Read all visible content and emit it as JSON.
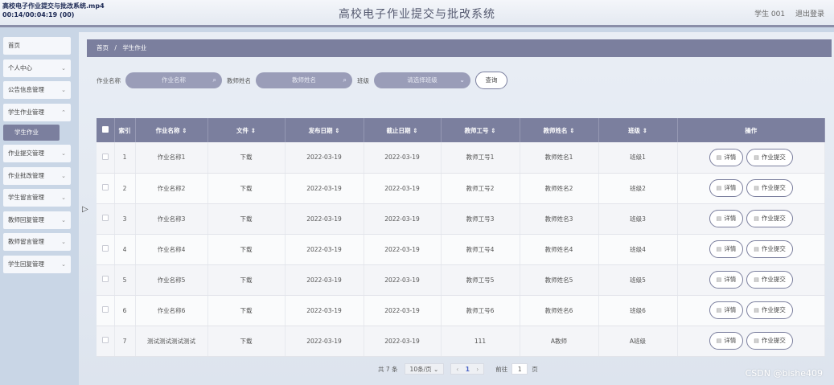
{
  "overlay": {
    "line1": "高校电子作业提交与批改系统.mp4",
    "line2": "00:14/00:04:19 (00)"
  },
  "header": {
    "title": "高校电子作业提交与批改系统",
    "user": "学生 001",
    "logout": "退出登录"
  },
  "sidebar": {
    "items": [
      {
        "label": "首页",
        "chev": ""
      },
      {
        "label": "个人中心",
        "chev": "⌄"
      },
      {
        "label": "公告信息管理",
        "chev": "⌄"
      },
      {
        "label": "学生作业管理",
        "chev": "⌃"
      }
    ],
    "active_sub": "学生作业",
    "items2": [
      {
        "label": "作业提交管理",
        "chev": "⌄"
      },
      {
        "label": "作业批改管理",
        "chev": "⌄"
      },
      {
        "label": "学生留言管理",
        "chev": "⌄"
      },
      {
        "label": "教师回复管理",
        "chev": "⌄"
      },
      {
        "label": "教师留言管理",
        "chev": "⌄"
      },
      {
        "label": "学生回复管理",
        "chev": "⌄"
      }
    ]
  },
  "breadcrumb": {
    "home": "首页",
    "sep": "/",
    "current": "学生作业"
  },
  "filter": {
    "hw_label": "作业名称",
    "hw_placeholder": "作业名称",
    "teacher_label": "教师姓名",
    "teacher_placeholder": "教师姓名",
    "class_label": "班级",
    "class_placeholder": "请选择班级",
    "query": "查询"
  },
  "table": {
    "headers": [
      "索引",
      "作业名称 ⇕",
      "文件 ⇕",
      "发布日期 ⇕",
      "截止日期 ⇕",
      "教师工号 ⇕",
      "教师姓名 ⇕",
      "班级 ⇕",
      "操作"
    ],
    "detail_label": "详情",
    "submit_label": "作业提交",
    "rows": [
      {
        "idx": "1",
        "name": "作业名称1",
        "file": "下载",
        "pub": "2022-03-19",
        "due": "2022-03-19",
        "tid": "教师工号1",
        "tname": "教师姓名1",
        "cls": "班级1"
      },
      {
        "idx": "2",
        "name": "作业名称2",
        "file": "下载",
        "pub": "2022-03-19",
        "due": "2022-03-19",
        "tid": "教师工号2",
        "tname": "教师姓名2",
        "cls": "班级2"
      },
      {
        "idx": "3",
        "name": "作业名称3",
        "file": "下载",
        "pub": "2022-03-19",
        "due": "2022-03-19",
        "tid": "教师工号3",
        "tname": "教师姓名3",
        "cls": "班级3"
      },
      {
        "idx": "4",
        "name": "作业名称4",
        "file": "下载",
        "pub": "2022-03-19",
        "due": "2022-03-19",
        "tid": "教师工号4",
        "tname": "教师姓名4",
        "cls": "班级4"
      },
      {
        "idx": "5",
        "name": "作业名称5",
        "file": "下载",
        "pub": "2022-03-19",
        "due": "2022-03-19",
        "tid": "教师工号5",
        "tname": "教师姓名5",
        "cls": "班级5"
      },
      {
        "idx": "6",
        "name": "作业名称6",
        "file": "下载",
        "pub": "2022-03-19",
        "due": "2022-03-19",
        "tid": "教师工号6",
        "tname": "教师姓名6",
        "cls": "班级6"
      },
      {
        "idx": "7",
        "name": "测试测试测试测试",
        "file": "下载",
        "pub": "2022-03-19",
        "due": "2022-03-19",
        "tid": "111",
        "tname": "A教师",
        "cls": "A班级"
      }
    ]
  },
  "pager": {
    "total": "共 7 条",
    "size": "10条/页 ⌄",
    "prev": "‹",
    "page": "1",
    "next": "›",
    "goto": "前往",
    "goto_page": "1",
    "unit": "页"
  },
  "watermark": "CSDN @bishe409"
}
